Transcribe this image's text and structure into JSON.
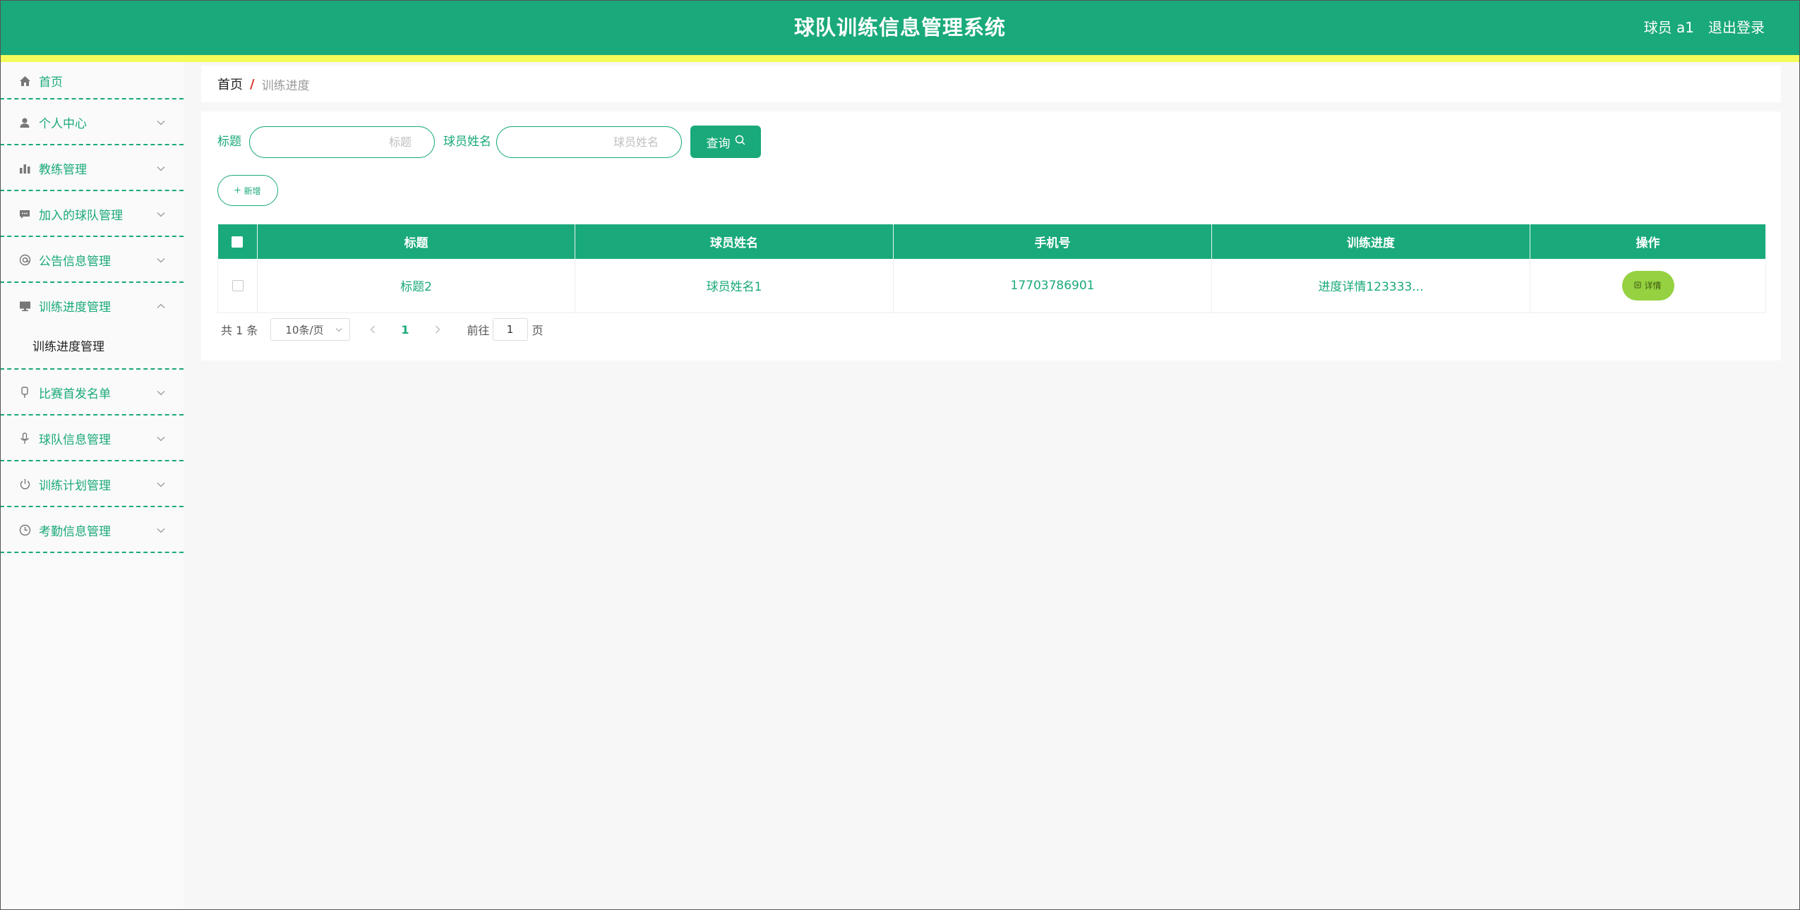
{
  "header": {
    "title": "球队训练信息管理系统",
    "user": "球员 a1",
    "logout": "退出登录",
    "color": "#1aa97a",
    "stripe_color": "#f4fb5a"
  },
  "sidebar": {
    "items": [
      {
        "label": "首页",
        "icon": "home-icon"
      },
      {
        "label": "个人中心",
        "icon": "user-icon"
      },
      {
        "label": "教练管理",
        "icon": "bar-chart-icon"
      },
      {
        "label": "加入的球队管理",
        "icon": "message-icon"
      },
      {
        "label": "公告信息管理",
        "icon": "at-icon"
      },
      {
        "label": "训练进度管理",
        "icon": "monitor-icon",
        "expanded": true,
        "children": [
          "训练进度管理"
        ]
      },
      {
        "label": "比赛首发名单",
        "icon": "badge-icon"
      },
      {
        "label": "球队信息管理",
        "icon": "microphone-icon"
      },
      {
        "label": "训练计划管理",
        "icon": "power-icon"
      },
      {
        "label": "考勤信息管理",
        "icon": "clock-icon"
      }
    ]
  },
  "breadcrumb": {
    "home": "首页",
    "separator": "/",
    "current": "训练进度"
  },
  "search": {
    "title_label": "标题",
    "title_placeholder": "标题",
    "player_label": "球员姓名",
    "player_placeholder": "球员姓名",
    "query_button": "查询"
  },
  "toolbar": {
    "add_button": "新增"
  },
  "table": {
    "columns": [
      "标题",
      "球员姓名",
      "手机号",
      "训练进度",
      "操作"
    ],
    "rows": [
      {
        "title": "标题2",
        "player": "球员姓名1",
        "phone": "17703786901",
        "progress": "进度详情123333...",
        "action": "详情"
      }
    ]
  },
  "pagination": {
    "total": "共 1 条",
    "page_size": "10条/页",
    "current_page": "1",
    "goto_label": "前往",
    "goto_value": "1",
    "goto_suffix": "页"
  }
}
